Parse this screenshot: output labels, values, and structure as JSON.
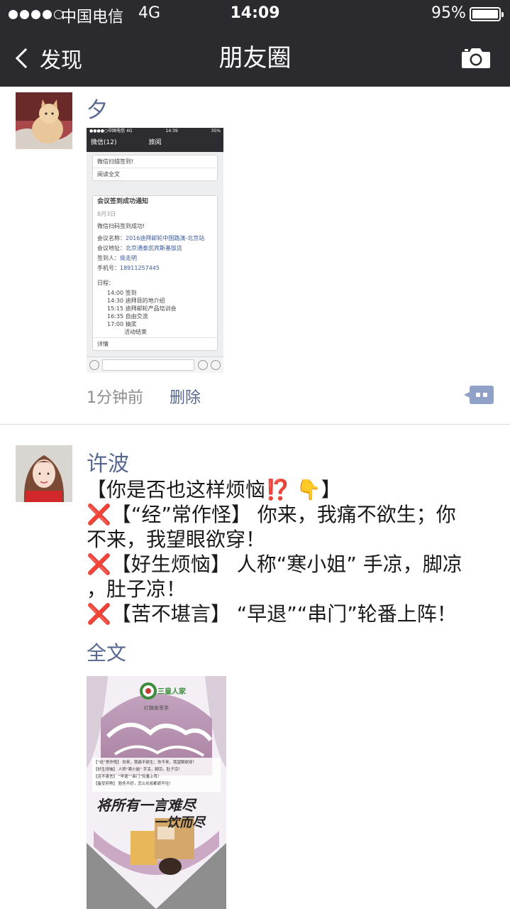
{
  "status_bar": {
    "carrier": "中国电信",
    "network": "4G",
    "time": "14:09",
    "battery": "95%",
    "battery_level": 0.95
  },
  "nav": {
    "back_label": "发现",
    "title": "朋友圈",
    "camera_icon": "camera-icon"
  },
  "posts": [
    {
      "name": "夕",
      "time": "1分钟前",
      "delete_label": "删除",
      "comment_icon": "comment-icon",
      "image": {
        "status_bar": {
          "carrier": "●●●●○中国电信 4G",
          "time": "14:39",
          "battery": "35%"
        },
        "nav": {
          "back": "微信(12)",
          "title": "旅阅"
        },
        "top_card": {
          "line1": "微信扫描签到!",
          "line2": "阅读全文"
        },
        "notice": {
          "title": "会议签到成功通知",
          "date": "8月3日",
          "success": "微信扫码签到成功!",
          "fields": [
            {
              "k": "会议名称：",
              "v": "2016迪拜邮轮中国路演-北京站"
            },
            {
              "k": "会议地址：",
              "v": "北京通泰凯宾斯基饭店"
            },
            {
              "k": "签到人：",
              "v": "侯走明"
            },
            {
              "k": "手机号：",
              "v": "18911257445"
            }
          ],
          "schedule_label": "日程：",
          "schedule": [
            "14:00 签到",
            "14:30 迪拜目的地介绍",
            "15:15 迪拜邮轮产品培训会",
            "16:35 自由交流",
            "17:00 抽奖",
            "活动结束"
          ],
          "details": "详情"
        }
      }
    },
    {
      "name": "许波",
      "lines": [
        "【你是否也这样烦恼⁉️ 👇】",
        "❌【“经”常作怪】 你来，我痛不欲生；你",
        "不来，我望眼欲穿！",
        "❌【好生烦恼】 人称“寒小姐” 手凉，脚凉",
        "，肚子凉！",
        "❌【苦不堪言】 “早退”“串门”轮番上阵！"
      ],
      "full_text_label": "全文",
      "poster": {
        "brand": "三皇人家",
        "slogan": "红糖姜枣茶",
        "list": [
          "【“经”常作怪】 你来，我痛不欲生；你不来，我望眼欲穿！",
          "【好生烦恼】 人称“寒小姐” 手凉，脚凉，肚子凉！",
          "【苦不堪言】 “早退”“串门”轮番上阵！",
          "【备受煎熬】 脸色不好，怎么化妆都遮不住！"
        ],
        "calligraphy1": "将所有一言难尽",
        "calligraphy2": "一饮而尽"
      }
    }
  ]
}
